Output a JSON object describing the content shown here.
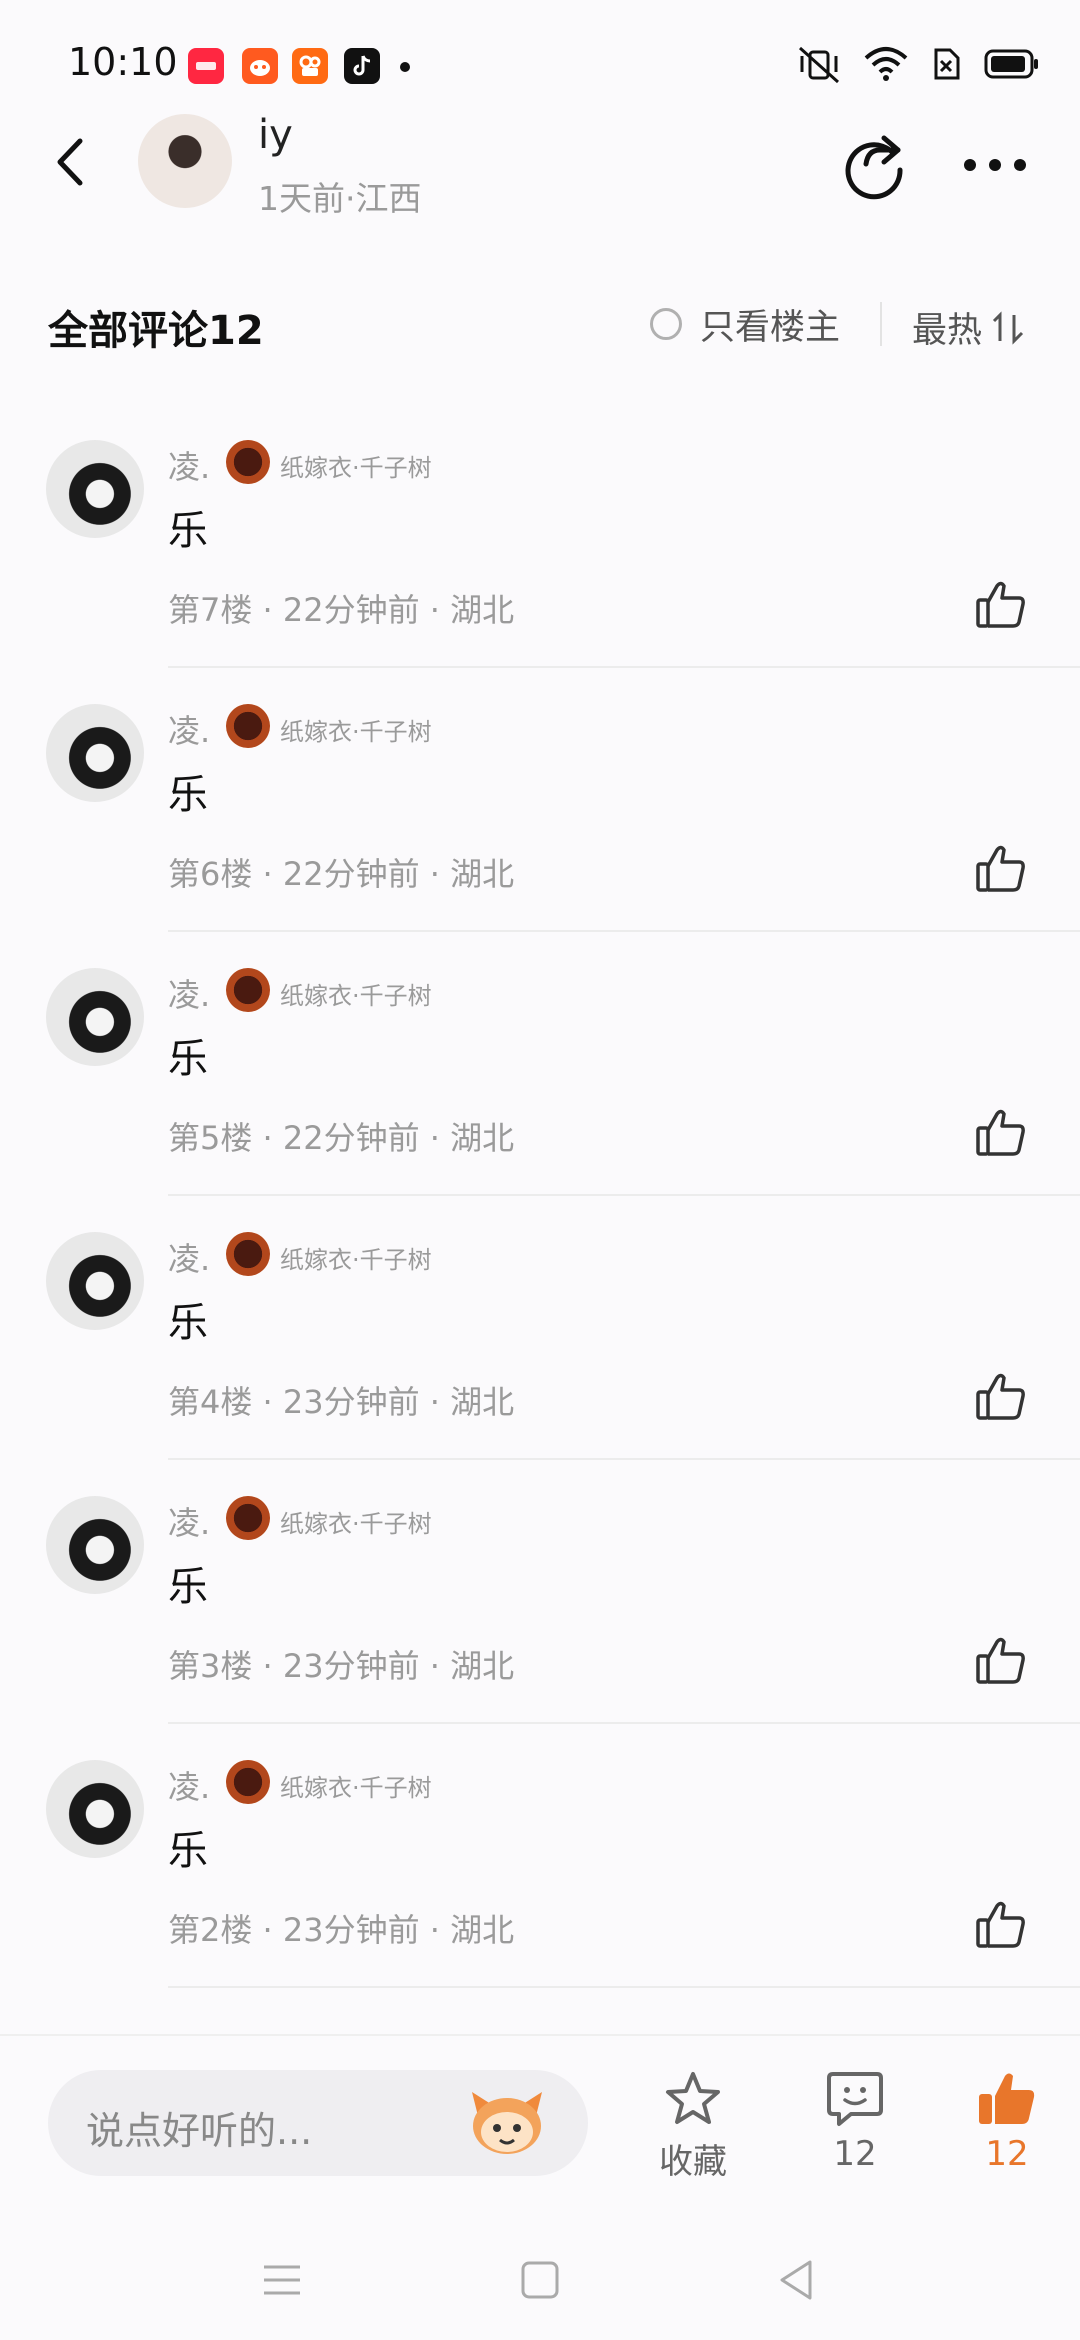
{
  "status_bar": {
    "time": "10:10",
    "notification_apps": [
      "xiaohongshu-app-icon",
      "taobao-app-icon",
      "kuaishou-app-icon",
      "tiktok-app-icon"
    ],
    "icons": [
      "vibrate-muted-icon",
      "wifi-icon",
      "sim-off-icon",
      "battery-icon"
    ]
  },
  "header": {
    "poster_name": "iy",
    "poster_meta": "1天前·江西"
  },
  "comments_header": {
    "title": "全部评论12",
    "owner_only_label": "只看楼主",
    "sort_label": "最热"
  },
  "comments": [
    {
      "user": "凌.",
      "badge": "纸嫁衣·千子树",
      "text": "乐",
      "meta": "第7楼 · 22分钟前 · 湖北"
    },
    {
      "user": "凌.",
      "badge": "纸嫁衣·千子树",
      "text": "乐",
      "meta": "第6楼 · 22分钟前 · 湖北"
    },
    {
      "user": "凌.",
      "badge": "纸嫁衣·千子树",
      "text": "乐",
      "meta": "第5楼 · 22分钟前 · 湖北"
    },
    {
      "user": "凌.",
      "badge": "纸嫁衣·千子树",
      "text": "乐",
      "meta": "第4楼 · 23分钟前 · 湖北"
    },
    {
      "user": "凌.",
      "badge": "纸嫁衣·千子树",
      "text": "乐",
      "meta": "第3楼 · 23分钟前 · 湖北"
    },
    {
      "user": "凌.",
      "badge": "纸嫁衣·千子树",
      "text": "乐",
      "meta": "第2楼 · 23分钟前 · 湖北"
    }
  ],
  "bottom_bar": {
    "input_placeholder": "说点好听的...",
    "favorite_label": "收藏",
    "comment_count": "12",
    "like_count": "12",
    "accent_color": "#e8762b"
  },
  "nav_bar": {
    "icons": [
      "menu-icon",
      "home-icon",
      "back-triangle-icon"
    ]
  }
}
